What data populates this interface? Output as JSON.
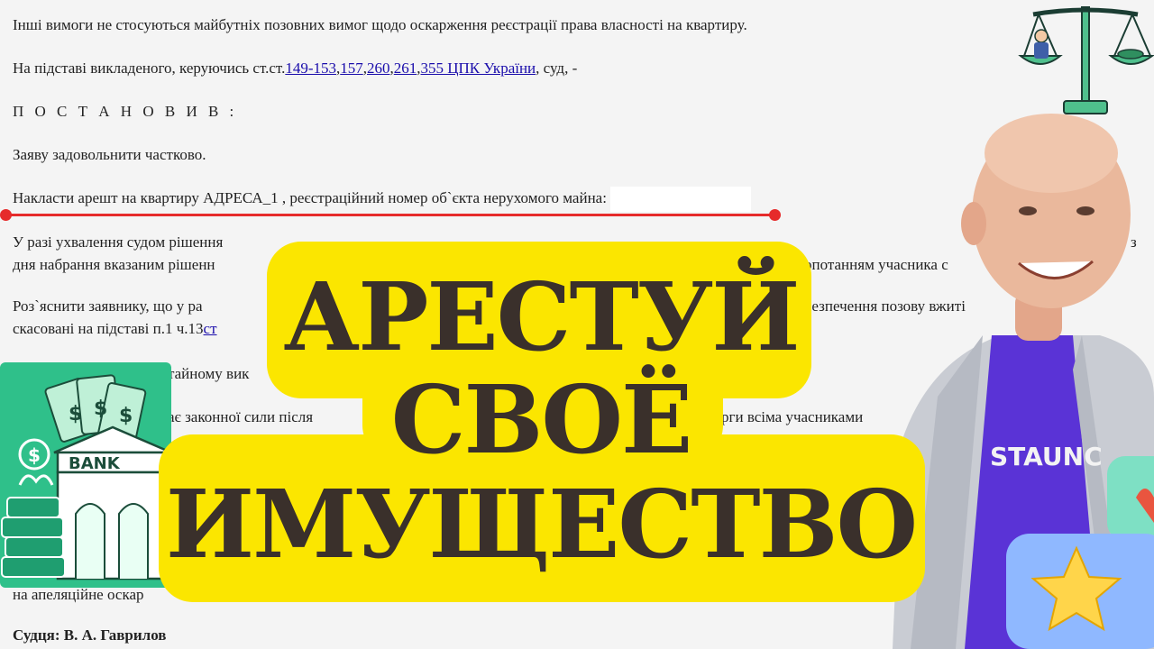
{
  "document": {
    "line1": "Інші вимоги не стосуються майбутніх позовних вимог щодо оскарження реєстрації права власності на квартиру.",
    "line2_prefix": "На підставі викладеного, керуючись ст.ст.",
    "line2_links": [
      "149-153",
      "157",
      "260",
      "261",
      "355 ЦПК України"
    ],
    "line2_suffix": ", суд, -",
    "decision_heading": "П О С Т А Н О В И В :",
    "line4": "Заяву задовольнити частково.",
    "line5": "Накласти арешт на квартиру АДРЕСА_1 , реєстраційний номер об`єкта нерухомого майна:",
    "line6a": "У разі ухвалення судом рішення",
    "line6a_end": "з",
    "line6b": "дня набрання вказаним рішенн",
    "line6b_end": "опотанням учасника с",
    "line7a": "Роз`яснити заявнику, що у ра",
    "line7a_end": "безпечення позову вжиті",
    "line7b": "скасовані на підставі п.1 ч.13",
    "line7b_link": "ст",
    "line8": "тайному вик",
    "line9": "ає законної сили після",
    "line9_end": "рги всіма учасниками",
    "line10": "на апеляційне оскар",
    "judge": "Судця: В. А. Гаврилов"
  },
  "headline": {
    "line1": "АРЕСТУЙ",
    "line2": "СВОЁ",
    "line3": "ИМУЩЕСТВО"
  },
  "bank_label": "BANK",
  "shirt_text": "STAUNC",
  "colors": {
    "banner": "#fbe600",
    "headline_text": "#3a302b",
    "highlight_line": "#e62b2b",
    "link": "#1a0dab",
    "bank_green": "#2fc08a",
    "shirt_blue": "#5a33d6"
  },
  "icons": [
    "scales-of-justice-icon",
    "bank-icon",
    "money-icon",
    "chat-bubble-icon",
    "star-icon",
    "heart-icon"
  ]
}
